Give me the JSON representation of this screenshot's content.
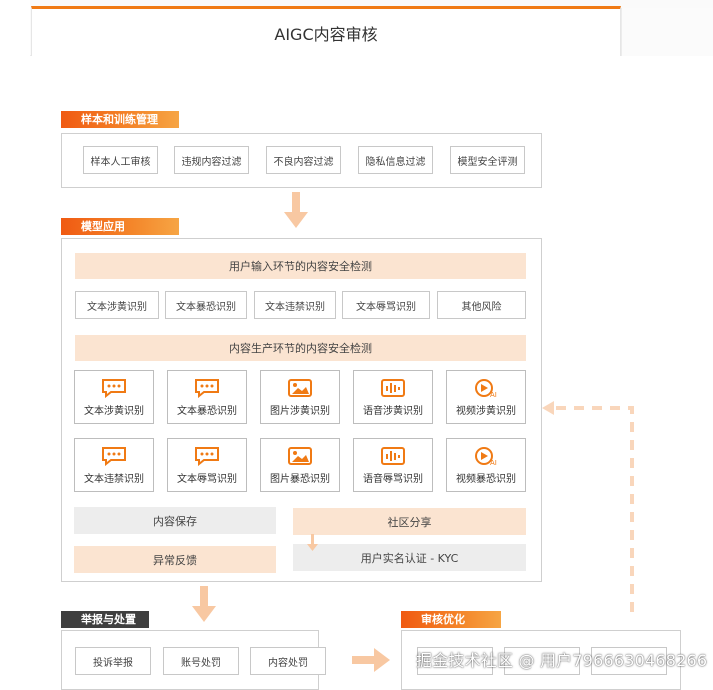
{
  "header": {
    "title": "AIGC内容审核"
  },
  "sections": {
    "sample": {
      "tag": "样本和训练管理",
      "items": [
        "样本人工审核",
        "违规内容过滤",
        "不良内容过滤",
        "隐私信息过滤",
        "模型安全评测"
      ]
    },
    "model": {
      "tag": "模型应用",
      "input_banner": "用户输入环节的内容安全检测",
      "input_items": [
        "文本涉黄识别",
        "文本暴恐识别",
        "文本违禁识别",
        "文本辱骂识别",
        "其他风险"
      ],
      "gen_banner": "内容生产环节的内容安全检测",
      "cards_row1": [
        "文本涉黄识别",
        "文本暴恐识别",
        "图片涉黄识别",
        "语音涉黄识别",
        "视频涉黄识别"
      ],
      "cards_row2": [
        "文本违禁识别",
        "文本辱骂识别",
        "图片暴恐识别",
        "语音辱骂识别",
        "视频暴恐识别"
      ],
      "save": "内容保存",
      "feedback": "异常反馈",
      "share": "社区分享",
      "kyc": "用户实名认证 - KYC"
    },
    "report": {
      "tag": "举报与处置",
      "items": [
        "投诉举报",
        "账号处罚",
        "内容处罚"
      ]
    },
    "optimize": {
      "tag": "审核优化"
    }
  },
  "watermark": "掘金技术社区 @ 用户7966630468266",
  "colors": {
    "accent": "#f07a14",
    "arrow": "#f8c8a2",
    "banner": "#fbe4d1",
    "gray_bar": "#ededed"
  },
  "icons": {
    "text": "chat-bubble-icon",
    "image": "image-icon",
    "audio": "audio-wave-icon",
    "video": "video-ai-icon"
  }
}
